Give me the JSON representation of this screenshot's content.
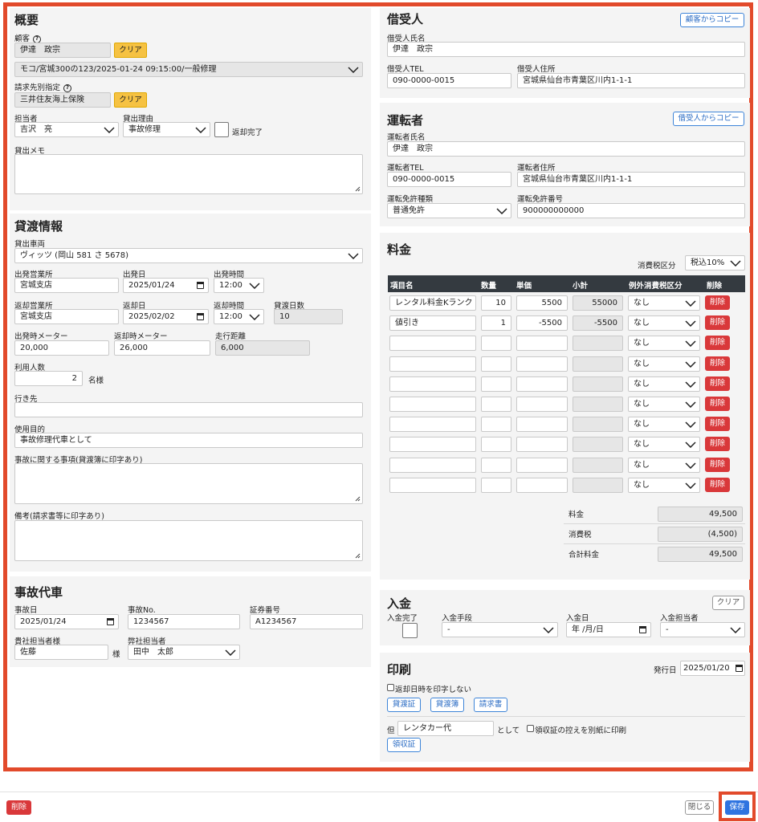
{
  "summary": {
    "title": "概要",
    "customer_label": "顧客",
    "customer_value": "伊達　政宗",
    "clear_label": "クリア",
    "vehicle_select": "モコ/宮城300の123/2025-01-24 09:15:00/一般修理",
    "billing_label": "請求先別指定",
    "billing_value": "三井住友海上保険",
    "staff_label": "担当者",
    "staff_value": "吉沢　亮",
    "reason_label": "貸出理由",
    "reason_value": "事故修理",
    "returned_label": "返却完了",
    "memo_label": "貸出メモ"
  },
  "lending": {
    "title": "貸渡情報",
    "vehicle_label": "貸出車両",
    "vehicle_value": "ヴィッツ (岡山 581 さ 5678)",
    "depart_office_label": "出発営業所",
    "depart_office_value": "宮城支店",
    "depart_date_label": "出発日",
    "depart_date_value": "2025/01/24",
    "depart_time_label": "出発時間",
    "depart_time_value": "12:00",
    "return_office_label": "返却営業所",
    "return_office_value": "宮城支店",
    "return_date_label": "返却日",
    "return_date_value": "2025/02/02",
    "return_time_label": "返却時間",
    "return_time_value": "12:00",
    "days_label": "貸渡日数",
    "days_value": "10",
    "depart_meter_label": "出発時メーター",
    "depart_meter_value": "20,000",
    "return_meter_label": "返却時メーター",
    "return_meter_value": "26,000",
    "distance_label": "走行距離",
    "distance_value": "6,000",
    "users_label": "利用人数",
    "users_value": "2",
    "users_unit": "名様",
    "destination_label": "行き先",
    "destination_value": "",
    "purpose_label": "使用目的",
    "purpose_value": "事故修理代車として",
    "accident_notes_label": "事故に関する事項(貸渡簿に印字あり)",
    "remarks_label": "備考(請求書等に印字あり)"
  },
  "accident": {
    "title": "事故代車",
    "date_label": "事故日",
    "date_value": "2025/01/24",
    "no_label": "事故No.",
    "no_value": "1234567",
    "policy_label": "証券番号",
    "policy_value": "A1234567",
    "contact_label": "貴社担当者様",
    "contact_value": "佐藤",
    "contact_suffix": "様",
    "our_staff_label": "弊社担当者",
    "our_staff_value": "田中　太郎"
  },
  "borrower": {
    "title": "借受人",
    "copy_label": "顧客からコピー",
    "name_label": "借受人氏名",
    "name_value": "伊達　政宗",
    "tel_label": "借受人TEL",
    "tel_value": "090-0000-0015",
    "address_label": "借受人住所",
    "address_value": "宮城県仙台市青葉区川内1-1-1"
  },
  "driver": {
    "title": "運転者",
    "copy_label": "借受人からコピー",
    "name_label": "運転者氏名",
    "name_value": "伊達　政宗",
    "tel_label": "運転者TEL",
    "tel_value": "090-0000-0015",
    "address_label": "運転者住所",
    "address_value": "宮城県仙台市青葉区川内1-1-1",
    "license_type_label": "運転免許種類",
    "license_type_value": "普通免許",
    "license_no_label": "運転免許番号",
    "license_no_value": "900000000000"
  },
  "fee": {
    "title": "料金",
    "tax_type_label": "消費税区分",
    "tax_type_value": "税込10%",
    "columns": [
      "項目名",
      "数量",
      "単価",
      "小計",
      "例外消費税区分",
      "削除"
    ],
    "rows": [
      {
        "item": "レンタル料金Kランク",
        "qty": "10",
        "price": "5500",
        "subtotal": "55000",
        "tax": "なし",
        "del": "削除"
      },
      {
        "item": "値引き",
        "qty": "1",
        "price": "-5500",
        "subtotal": "-5500",
        "tax": "なし",
        "del": "削除"
      },
      {
        "item": "",
        "qty": "",
        "price": "",
        "subtotal": "",
        "tax": "なし",
        "del": "削除"
      },
      {
        "item": "",
        "qty": "",
        "price": "",
        "subtotal": "",
        "tax": "なし",
        "del": "削除"
      },
      {
        "item": "",
        "qty": "",
        "price": "",
        "subtotal": "",
        "tax": "なし",
        "del": "削除"
      },
      {
        "item": "",
        "qty": "",
        "price": "",
        "subtotal": "",
        "tax": "なし",
        "del": "削除"
      },
      {
        "item": "",
        "qty": "",
        "price": "",
        "subtotal": "",
        "tax": "なし",
        "del": "削除"
      },
      {
        "item": "",
        "qty": "",
        "price": "",
        "subtotal": "",
        "tax": "なし",
        "del": "削除"
      },
      {
        "item": "",
        "qty": "",
        "price": "",
        "subtotal": "",
        "tax": "なし",
        "del": "削除"
      },
      {
        "item": "",
        "qty": "",
        "price": "",
        "subtotal": "",
        "tax": "なし",
        "del": "削除"
      }
    ],
    "fee_label": "料金",
    "fee_value": "49,500",
    "tax_label": "消費税",
    "tax_value": "(4,500)",
    "total_label": "合計料金",
    "total_value": "49,500"
  },
  "payment": {
    "title": "入金",
    "clear_label": "クリア",
    "done_label": "入金完了",
    "method_label": "入金手段",
    "method_value": "-",
    "date_label": "入金日",
    "date_value": "年 /月/日",
    "staff_label": "入金担当者",
    "staff_value": "-"
  },
  "print": {
    "title": "印刷",
    "issue_date_label": "発行日",
    "issue_date_value": "2025/01/20",
    "no_return_label": "返却日時を印字しない",
    "btn_lending_cert": "貸渡証",
    "btn_lending_book": "貸渡簿",
    "btn_invoice": "請求書",
    "tadashi_label": "但",
    "tadashi_value": "レンタカー代",
    "toshite_label": "として",
    "receipt_copy_label": "領収証の控えを別紙に印刷",
    "btn_receipt": "領収証"
  },
  "footer": {
    "delete_label": "削除",
    "close_label": "閉じる",
    "save_label": "保存"
  },
  "colors": {
    "highlight": "#e24a2b",
    "danger": "#d9383a",
    "primary": "#2f74e0",
    "warning": "#f6c242"
  }
}
